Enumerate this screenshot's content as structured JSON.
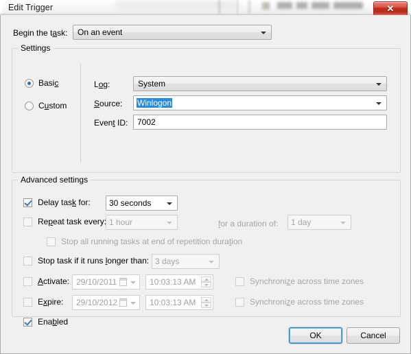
{
  "window": {
    "title": "Edit Trigger",
    "close_label": "✕",
    "close_icon": "close-icon"
  },
  "begin": {
    "label": "Begin the task:",
    "label_pre": "Begin the t",
    "label_accel": "a",
    "label_post": "sk:",
    "value": "On an event"
  },
  "settings": {
    "title": "Settings",
    "mode": {
      "basic": {
        "label_pre": "Basi",
        "label_accel": "c",
        "label_post": "",
        "checked": true
      },
      "custom": {
        "label_pre": "C",
        "label_accel": "u",
        "label_post": "stom",
        "checked": false
      }
    },
    "fields": {
      "log": {
        "label_pre": "L",
        "label_accel": "o",
        "label_post": "g:",
        "value": "System",
        "enabled": true
      },
      "source": {
        "label_pre": "",
        "label_accel": "S",
        "label_post": "ource:",
        "value": "Winlogon",
        "selected": true
      },
      "event_id": {
        "label_pre": "Even",
        "label_accel": "t",
        "label_post": " ID:",
        "value": "7002"
      }
    }
  },
  "advanced": {
    "title": "Advanced settings",
    "delay_task": {
      "label_pre": "Delay tas",
      "label_accel": "k",
      "label_post": " for:",
      "checked": true,
      "value": "30 seconds",
      "enabled": true
    },
    "repeat_task": {
      "label_pre": "Re",
      "label_accel": "p",
      "label_post": "eat task every:",
      "checked": false,
      "value": "1 hour",
      "enabled": false
    },
    "duration": {
      "label_pre": "",
      "label_accel": "f",
      "label_post": "or a duration of:",
      "value": "1 day",
      "enabled": false
    },
    "stop_all_running": {
      "label_pre": "Stop all running tasks at end of repetition dura",
      "label_accel": "t",
      "label_post": "ion",
      "checked": false,
      "enabled": false
    },
    "stop_task_longer": {
      "label_pre": "Stop task if it runs ",
      "label_accel": "l",
      "label_post": "onger than:",
      "checked": false,
      "value": "3 days",
      "enabled": false
    },
    "activate": {
      "label_pre": "",
      "label_accel": "A",
      "label_post": "ctivate:",
      "checked": false,
      "date": "29/10/2011",
      "time": "10:03:13 AM",
      "sync": {
        "label_pre": "Synchroni",
        "label_accel": "z",
        "label_post": "e across time zones",
        "checked": false,
        "enabled": false
      }
    },
    "expire": {
      "label_pre": "E",
      "label_accel": "x",
      "label_post": "pire:",
      "checked": false,
      "date": "29/10/2012",
      "time": "10:03:13 AM",
      "sync": {
        "label_pre": "Synchroni",
        "label_accel": "z",
        "label_post": "e across time zones",
        "checked": false,
        "enabled": false
      }
    },
    "enabled": {
      "label_pre": "Ena",
      "label_accel": "b",
      "label_post": "led",
      "checked": true
    }
  },
  "footer": {
    "ok_label": "OK",
    "cancel_label": "Cancel"
  },
  "colors": {
    "dialog_bg": "#f0f0f0",
    "selection_blue": "#2a8bdd",
    "focus_blue": "#60b0e8",
    "close_red": "#c33122",
    "disabled_text": "#a6a6a6"
  }
}
